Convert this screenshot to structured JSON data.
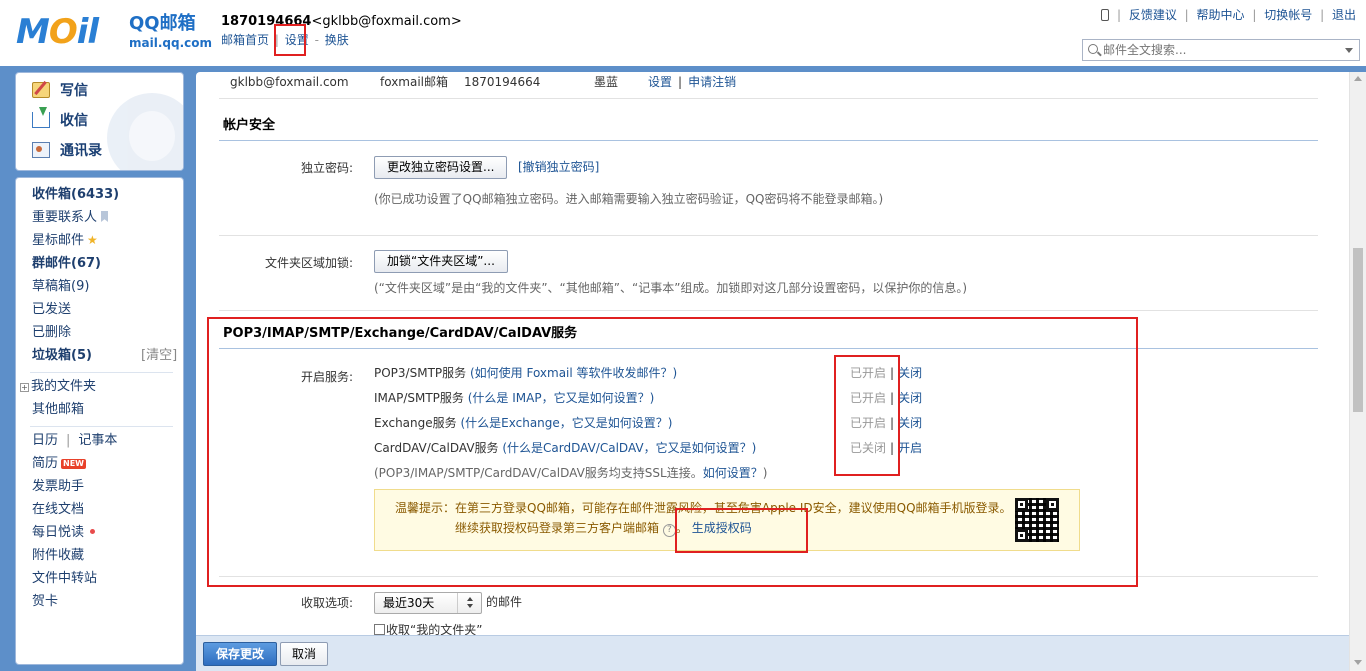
{
  "header": {
    "logo_text": "MOil",
    "logo_brand": "QQ邮箱",
    "logo_url": "mail.qq.com",
    "user_id": "1870194664",
    "user_email": "<gklbb@foxmail.com>",
    "links": [
      "邮箱首页",
      "设置",
      "换肤"
    ],
    "link_sep": "|",
    "link_dash": "-",
    "top_right": [
      "反馈建议",
      "帮助中心",
      "切换帐号",
      "退出"
    ],
    "search_placeholder": "邮件全文搜索..."
  },
  "sidebar": {
    "quick_actions": [
      {
        "label": "写信",
        "icon": "pencil-icon"
      },
      {
        "label": "收信",
        "icon": "inbox-download-icon"
      },
      {
        "label": "通讯录",
        "icon": "contacts-icon"
      }
    ],
    "folders": [
      {
        "label": "收件箱(6433)"
      },
      {
        "label": "重要联系人"
      },
      {
        "label": "星标邮件"
      },
      {
        "label": "群邮件(67)"
      },
      {
        "label": "草稿箱(9)"
      },
      {
        "label": "已发送"
      },
      {
        "label": "已删除"
      },
      {
        "label": "垃圾箱(5)",
        "action": "[清空]"
      }
    ],
    "my_folders": "我的文件夹",
    "other_mailbox": "其他邮箱",
    "calendar": "日历",
    "notebook": "记事本",
    "apps": [
      {
        "label": "简历",
        "badge": "NEW"
      },
      {
        "label": "发票助手"
      },
      {
        "label": "在线文档"
      },
      {
        "label": "每日悦读"
      },
      {
        "label": "附件收藏"
      },
      {
        "label": "文件中转站"
      },
      {
        "label": "贺卡"
      }
    ]
  },
  "account_row": {
    "email": "gklbb@foxmail.com",
    "type": "foxmail邮箱",
    "number": "1870194664",
    "color": "墨蓝",
    "settings": "设置",
    "cancel": "申请注销"
  },
  "security": {
    "title": "帐户安全",
    "pwd_label": "独立密码:",
    "pwd_button": "更改独立密码设置...",
    "pwd_revoke": "[撤销独立密码]",
    "pwd_note": "(你已成功设置了QQ邮箱独立密码。进入邮箱需要输入独立密码验证，QQ密码将不能登录邮箱。)",
    "lock_label": "文件夹区域加锁:",
    "lock_button": "加锁“文件夹区域”...",
    "lock_note": "(“文件夹区域”是由“我的文件夹”、“其他邮箱”、“记事本”组成。加锁即对这几部分设置密码，以保护你的信息。)"
  },
  "pop3": {
    "title": "POP3/IMAP/SMTP/Exchange/CardDAV/CalDAV服务",
    "enable_label": "开启服务:",
    "services": [
      {
        "name": "POP3/SMTP服务",
        "help": "(如何使用 Foxmail 等软件收发邮件？)",
        "status": "已开启",
        "action": "关闭"
      },
      {
        "name": "IMAP/SMTP服务",
        "help": "(什么是 IMAP，它又是如何设置？)",
        "status": "已开启",
        "action": "关闭"
      },
      {
        "name": "Exchange服务",
        "help": "(什么是Exchange，它又是如何设置？)",
        "status": "已开启",
        "action": "关闭"
      },
      {
        "name": "CardDAV/CalDAV服务",
        "help": "(什么是CardDAV/CalDAV，它又是如何设置？)",
        "status": "已关闭",
        "action": "开启"
      }
    ],
    "ssl_note": "(POP3/IMAP/SMTP/CardDAV/CalDAV服务均支持SSL连接。",
    "ssl_link": "如何设置？",
    "ssl_close": ")",
    "tip_line1": "温馨提示：在第三方登录QQ邮箱，可能存在邮件泄露风险，甚至危害Apple ID安全，建议使用QQ邮箱手机版登录。",
    "tip_line2": "继续获取授权码登录第三方客户端邮箱",
    "tip_help": "?",
    "tip_period": "。",
    "auth_link": "生成授权码"
  },
  "receive": {
    "label": "收取选项:",
    "range": "最近30天",
    "suffix": "的邮件",
    "checkbox_label": "收取“我的文件夹”"
  },
  "footer": {
    "save": "保存更改",
    "cancel": "取消"
  }
}
